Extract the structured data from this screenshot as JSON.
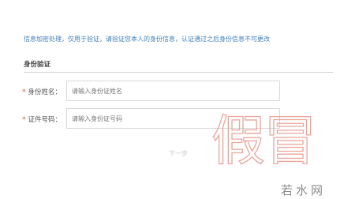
{
  "notice": "信息加密处理，仅用于验证，请验证您本人的身份信息，认证通过之后身份信息不可更改",
  "section": {
    "title": "身份验证"
  },
  "form": {
    "name": {
      "required_mark": "*",
      "label": "身份姓名：",
      "placeholder": "请输入身份证姓名",
      "value": ""
    },
    "id_number": {
      "required_mark": "*",
      "label": "证件号码：",
      "placeholder": "请输入身份证号码",
      "value": ""
    },
    "next_label": "下一步"
  },
  "overlay": {
    "stamp_text": "假冒",
    "watermark_text": "若水网"
  }
}
